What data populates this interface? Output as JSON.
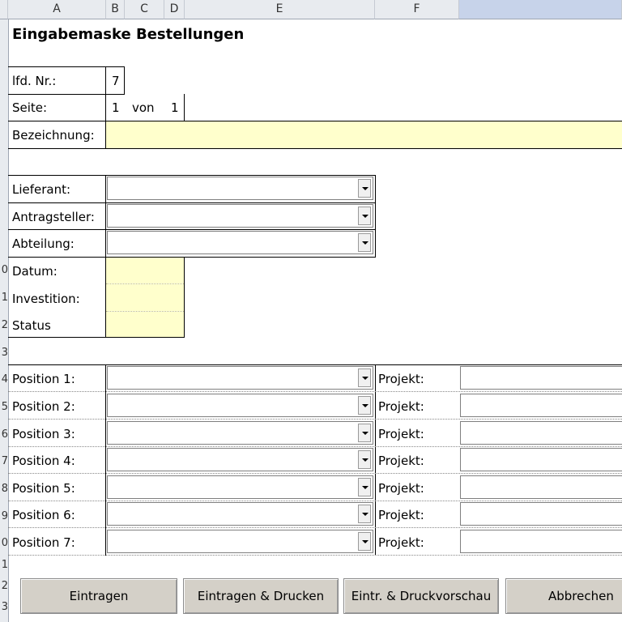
{
  "columns": [
    "A",
    "B",
    "C",
    "D",
    "E",
    "F",
    ""
  ],
  "row_numbers": [
    "0",
    "1",
    "2",
    "3",
    "4",
    "5",
    "6",
    "7",
    "8",
    "9",
    "0",
    "1",
    "2",
    "3"
  ],
  "title": "Eingabemaske Bestellungen",
  "header_fields": {
    "lfd_label": "lfd. Nr.:",
    "lfd_value": "7",
    "seite_label": "Seite:",
    "seite_current": "1",
    "seite_of": "von",
    "seite_total": "1",
    "bezeichnung_label": "Bezeichnung:",
    "bezeichnung_value": ""
  },
  "dropdowns": [
    {
      "label": "Lieferant:",
      "value": ""
    },
    {
      "label": "Antragsteller:",
      "value": ""
    },
    {
      "label": "Abteilung:",
      "value": ""
    }
  ],
  "info_fields": [
    {
      "label": "Datum:",
      "value": ""
    },
    {
      "label": "Investition:",
      "value": ""
    },
    {
      "label": "Status",
      "value": ""
    }
  ],
  "positions": [
    {
      "label": "Position 1:",
      "value": "",
      "projekt_label": "Projekt:",
      "projekt_value": ""
    },
    {
      "label": "Position 2:",
      "value": "",
      "projekt_label": "Projekt:",
      "projekt_value": ""
    },
    {
      "label": "Position 3:",
      "value": "",
      "projekt_label": "Projekt:",
      "projekt_value": ""
    },
    {
      "label": "Position 4:",
      "value": "",
      "projekt_label": "Projekt:",
      "projekt_value": ""
    },
    {
      "label": "Position 5:",
      "value": "",
      "projekt_label": "Projekt:",
      "projekt_value": ""
    },
    {
      "label": "Position 6:",
      "value": "",
      "projekt_label": "Projekt:",
      "projekt_value": ""
    },
    {
      "label": "Position 7:",
      "value": "",
      "projekt_label": "Projekt:",
      "projekt_value": ""
    }
  ],
  "buttons": {
    "eintragen": "Eintragen",
    "eintragen_drucken": "Eintragen & Drucken",
    "eintr_druckvorschau": "Eintr. & Druckvorschau",
    "abbrechen": "Abbrechen"
  }
}
